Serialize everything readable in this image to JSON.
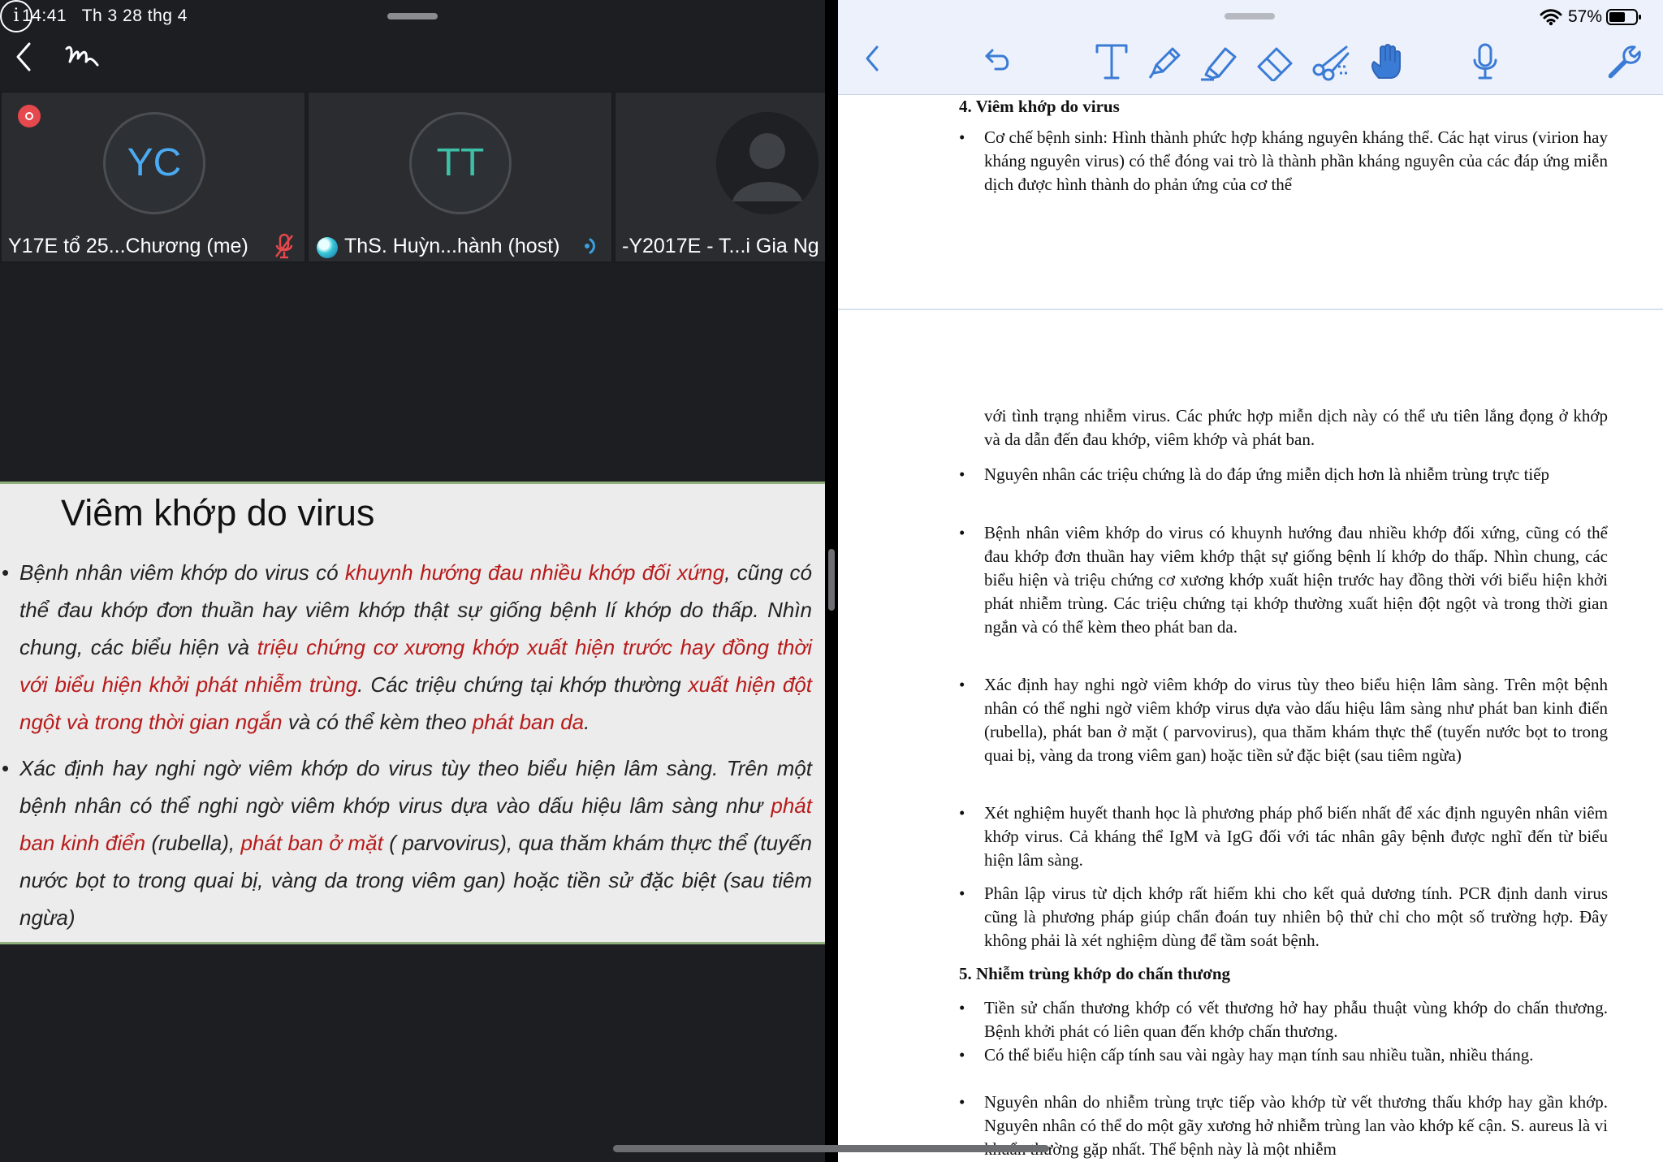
{
  "status_bar": {
    "time": "14:41",
    "date": "Th 3 28 thg 4",
    "battery": "57%"
  },
  "call": {
    "participants": [
      {
        "initials": "YC",
        "name": "Y17E tổ 25...Chương (me)"
      },
      {
        "initials": "TT",
        "name": "ThS. Huỳn...hành (host)"
      },
      {
        "initials": "",
        "name": "-Y2017E - T...i Gia Ng"
      }
    ],
    "info_label": "i"
  },
  "slide": {
    "title": "Viêm khớp do virus",
    "bullet1": {
      "p1": "Bệnh nhân viêm khớp do virus có ",
      "r1": "khuynh hướng đau nhiều khớp đối xứng",
      "p2": ", cũng có thể đau khớp đơn thuần hay viêm khớp thật sự giống bệnh lí khớp do thấp. Nhìn chung, các biểu hiện và ",
      "r2": "triệu chứng cơ xương khớp xuất hiện trước hay đồng thời với biểu hiện khởi phát nhiễm trùng",
      "p3": ". Các triệu chứng tại khớp thường ",
      "r3": "xuất hiện đột ngột và trong thời gian ngắn",
      "p4": " và có thể kèm theo ",
      "r4": "phát ban da",
      "p5": "."
    },
    "bullet2": {
      "p1": "Xác định hay nghi ngờ viêm khớp do virus tùy theo biểu hiện lâm sàng. Trên một bệnh nhân có thể nghi ngờ viêm khớp virus dựa vào dấu hiệu lâm sàng như ",
      "r1": "phát ban kinh điển",
      "p2": " (rubella), ",
      "r2": "phát ban ở mặt",
      "p3": " ( parvovirus), qua thăm khám thực thể (tuyến nước bọt to trong quai bị, vàng da trong viêm gan) hoặc tiền sử đặc biệt (sau tiêm ngừa)"
    }
  },
  "doc": {
    "heading4": "4.  Viêm khớp do virus",
    "p1": "Cơ chế bệnh sinh: Hình thành phức hợp kháng nguyên kháng thể. Các hạt virus (virion hay kháng nguyên virus) có thể đóng vai trò là thành phần kháng nguyên của các đáp ứng miễn dịch được hình thành do phản ứng của cơ thể",
    "p1_cont": "với tình trạng nhiễm virus. Các phức hợp miễn dịch này có thể ưu tiên lắng đọng ở khớp và da dẫn đến đau khớp, viêm khớp và phát ban.",
    "p2": "Nguyên nhân các triệu chứng là do đáp ứng miễn dịch hơn là nhiễm trùng trực tiếp",
    "p3": "Bệnh nhân viêm khớp do virus có khuynh hướng đau nhiều khớp đối xứng, cũng có thể đau khớp đơn thuần hay viêm khớp thật sự giống bệnh lí khớp do thấp. Nhìn chung, các biểu hiện và triệu chứng cơ xương khớp xuất hiện trước hay đồng thời với biểu hiện khởi phát nhiễm trùng. Các triệu chứng tại khớp thường xuất hiện đột ngột và trong thời gian ngắn và có thể kèm theo phát ban da.",
    "p4": "Xác định hay nghi ngờ viêm khớp do virus tùy theo biểu hiện lâm sàng. Trên một bệnh nhân có thể nghi ngờ viêm khớp virus dựa vào dấu hiệu lâm sàng như phát ban kinh điển (rubella), phát ban ở mặt ( parvovirus), qua thăm khám thực thể (tuyến nước bọt to trong quai bị, vàng da trong viêm gan) hoặc tiền sử đặc biệt (sau tiêm ngừa)",
    "p5": "Xét nghiệm huyết thanh học là phương pháp phổ biến nhất để xác định nguyên nhân viêm khớp virus. Cả kháng thể IgM và IgG đối với tác nhân gây bệnh được nghĩ đến từ biểu hiện lâm sàng.",
    "p6": "Phân lập virus từ dịch khớp rất hiếm khi cho kết quả dương tính. PCR định danh virus cũng là phương pháp giúp chẩn đoán tuy nhiên bộ thử chỉ cho một số trường hợp. Đây không phải là xét nghiệm dùng để tầm soát bệnh.",
    "heading5": "5. Nhiễm trùng khớp do chấn thương",
    "p7": "Tiền sử chấn thương khớp có vết thương hở hay phẫu thuật vùng khớp do chấn thương. Bệnh khởi phát có liên quan đến khớp chấn thương.",
    "p8": "Có thể biểu hiện cấp tính sau vài ngày hay mạn tính sau nhiều tuần, nhiều tháng.",
    "p9": "Nguyên nhân do nhiễm trùng trực tiếp vào khớp từ vết thương thấu khớp hay gần khớp. Nguyên nhân có thể do một gãy xương hở nhiễm trùng lan vào khớp kế cận. S. aureus là vi khuẩn thường gặp nhất. Thể bệnh này là một nhiễm"
  },
  "colors": {
    "accent_blue": "#3a7bd5",
    "slide_red": "#b81a1a",
    "record_red": "#e5484d"
  }
}
